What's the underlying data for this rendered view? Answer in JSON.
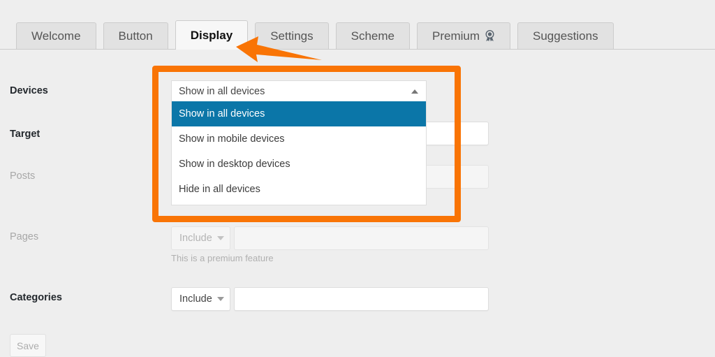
{
  "tabs": [
    {
      "label": "Welcome",
      "active": false,
      "icon": null
    },
    {
      "label": "Button",
      "active": false,
      "icon": null
    },
    {
      "label": "Display",
      "active": true,
      "icon": null
    },
    {
      "label": "Settings",
      "active": false,
      "icon": null
    },
    {
      "label": "Scheme",
      "active": false,
      "icon": null
    },
    {
      "label": "Premium",
      "active": false,
      "icon": "award-icon"
    },
    {
      "label": "Suggestions",
      "active": false,
      "icon": null
    }
  ],
  "form": {
    "devices": {
      "label": "Devices",
      "selected": "Show in all devices",
      "options": [
        "Show in all devices",
        "Show in mobile devices",
        "Show in desktop devices",
        "Hide in all devices"
      ],
      "expanded": true
    },
    "target": {
      "label": "Target",
      "value": "",
      "disabled": false
    },
    "posts": {
      "label": "Posts",
      "value": "",
      "disabled": true
    },
    "pages": {
      "label": "Pages",
      "select_value": "Include",
      "value": "",
      "helper": "This is a premium feature",
      "disabled": true
    },
    "categories": {
      "label": "Categories",
      "select_value": "Include",
      "value": "",
      "disabled": false
    }
  },
  "footer": {
    "save_label": "Save"
  },
  "annotations": {
    "highlight_color": "#f97405",
    "arrow_name": "left-arrow-annotation",
    "highlight_name": "devices-dropdown-highlight"
  },
  "colors": {
    "selected_option_blue": "#0b76a8",
    "page_background": "#eeeeee",
    "active_tab_background": "#f7f7f7"
  }
}
